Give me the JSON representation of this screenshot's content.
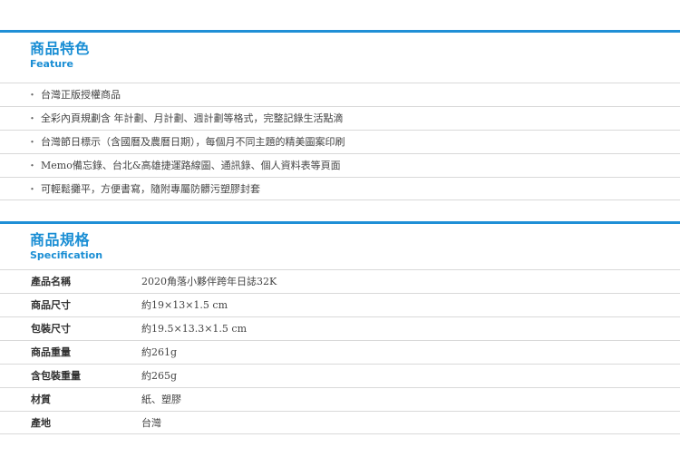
{
  "feature": {
    "title_zh": "商品特色",
    "title_en": "Feature",
    "bullet": "・",
    "items": [
      "台灣正版授權商品",
      "全彩內頁規劃含 年計劃、月計劃、週計劃等格式，完整記錄生活點滴",
      "台灣節日標示（含國曆及農曆日期），每個月不同主題的精美圖案印刷",
      "Memo備忘錄、台北&高雄捷運路線圖、通訊錄、個人資料表等頁面",
      "可輕鬆攤平，方便書寫，隨附專屬防髒污塑膠封套"
    ]
  },
  "spec": {
    "title_zh": "商品規格",
    "title_en": "Specification",
    "rows": [
      {
        "label": "產品名稱",
        "value": "2020角落小夥伴跨年日誌32K"
      },
      {
        "label": "商品尺寸",
        "value": "約19×13×1.5 cm"
      },
      {
        "label": "包裝尺寸",
        "value": "約19.5×13.3×1.5 cm"
      },
      {
        "label": "商品重量",
        "value": "約261g"
      },
      {
        "label": "含包裝重量",
        "value": "約265g"
      },
      {
        "label": "材質",
        "value": "紙、塑膠"
      },
      {
        "label": "產地",
        "value": "台灣"
      }
    ]
  },
  "colors": {
    "accent": "#1f8fd6",
    "divider": "#d9d9d9"
  }
}
